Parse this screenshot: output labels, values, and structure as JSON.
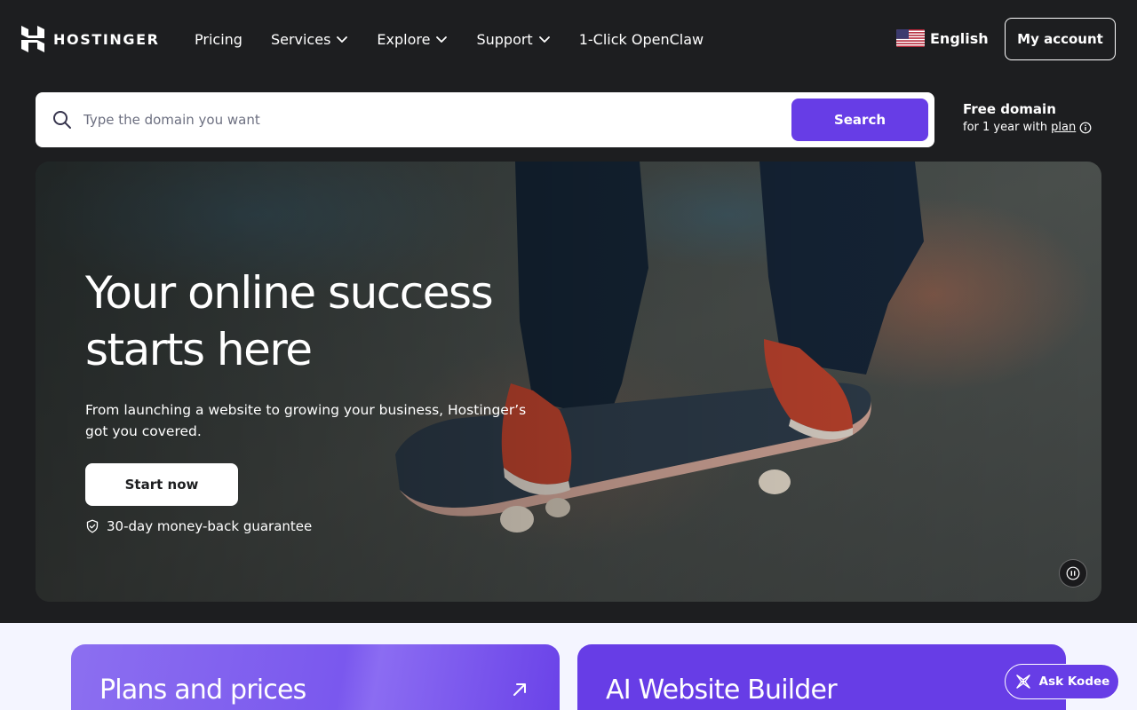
{
  "header": {
    "brand": "HOSTINGER",
    "nav": [
      {
        "label": "Pricing",
        "has_dropdown": false
      },
      {
        "label": "Services",
        "has_dropdown": true
      },
      {
        "label": "Explore",
        "has_dropdown": true
      },
      {
        "label": "Support",
        "has_dropdown": true
      },
      {
        "label": "1-Click OpenClaw",
        "has_dropdown": false
      }
    ],
    "language": "English",
    "language_flag_icon": "us-flag-icon",
    "account_label": "My account"
  },
  "domain_search": {
    "placeholder": "Type the domain you want",
    "value": "",
    "button_label": "Search",
    "free_title": "Free domain",
    "free_sub_prefix": "for 1 year with",
    "free_sub_link": "plan"
  },
  "hero": {
    "title_line1": "Your online success",
    "title_line2": "starts here",
    "subtitle": "From launching a website to growing your business, Hostinger’s got you covered.",
    "cta_label": "Start now",
    "guarantee": "30-day money-back guarantee"
  },
  "cards": [
    {
      "title": "Plans and prices"
    },
    {
      "title": "AI Website Builder"
    }
  ],
  "chat": {
    "label": "Ask Kodee"
  },
  "colors": {
    "accent": "#673de6",
    "background": "#1d1e20",
    "lower_bg": "#f4f5ff"
  }
}
